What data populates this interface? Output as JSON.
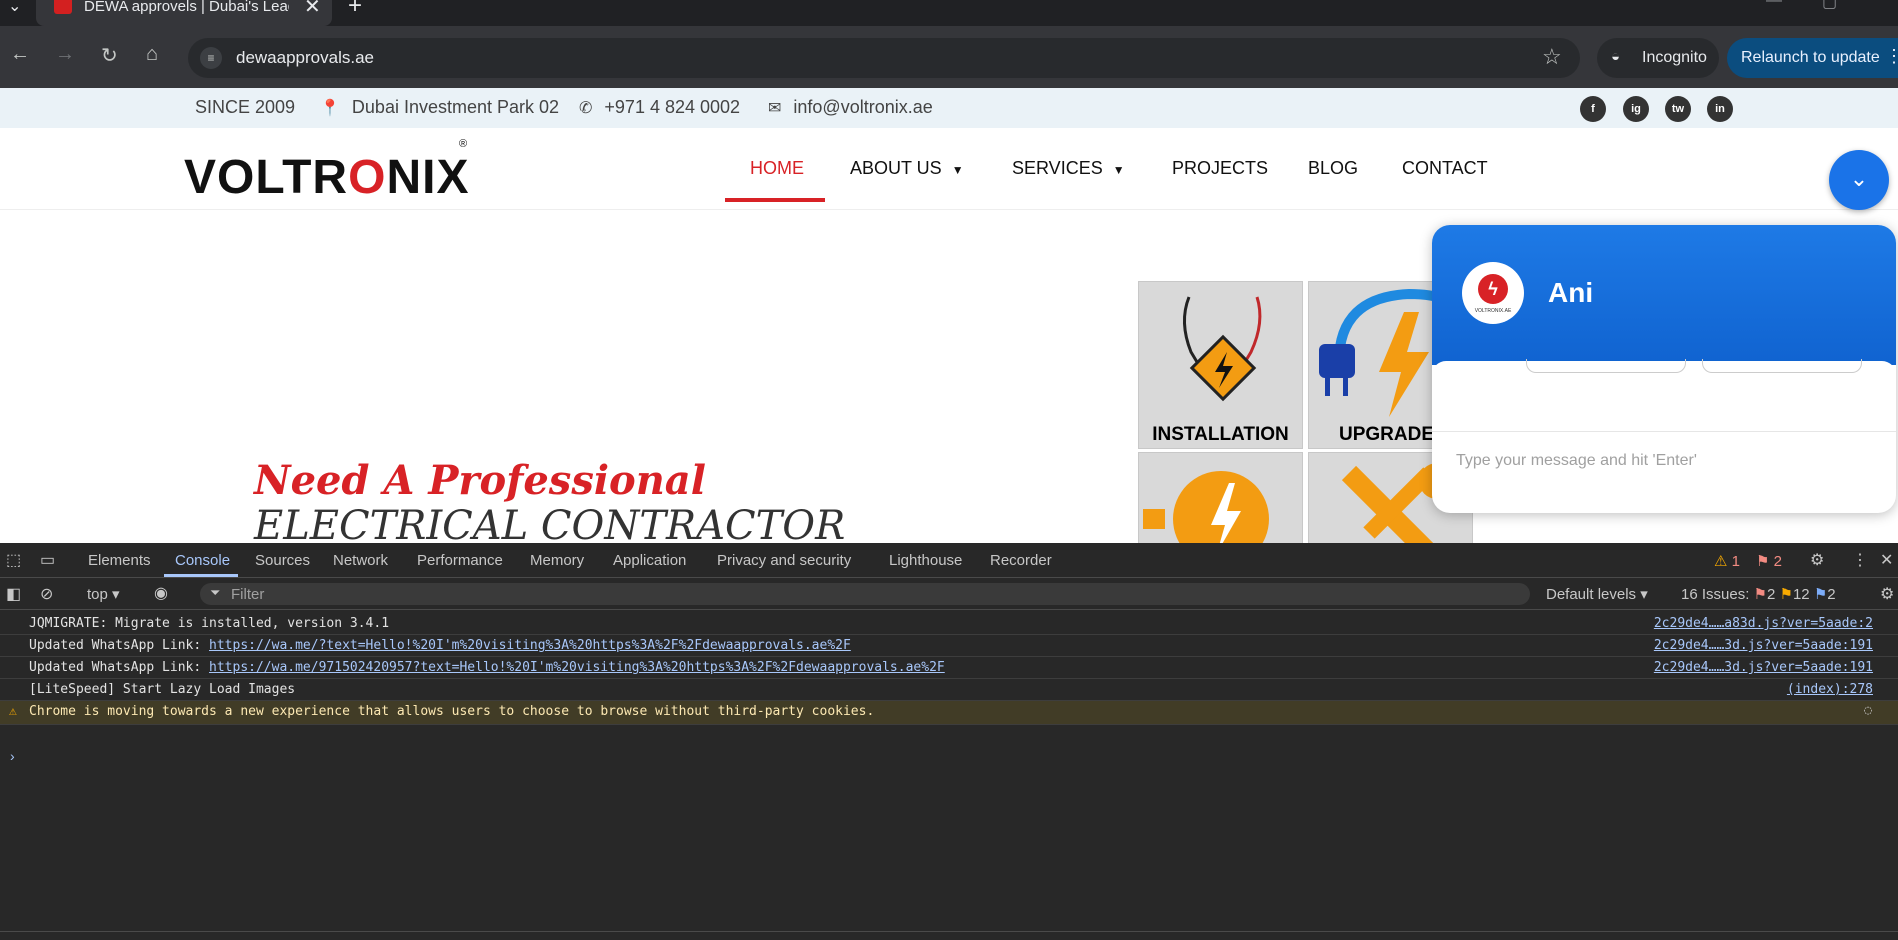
{
  "browser": {
    "tab_title": "DEWA approvels | Dubai's Leading",
    "close_glyph": "✕",
    "newtab_glyph": "+",
    "url": "dewaapprovals.ae",
    "incognito_label": "Incognito",
    "relaunch_label": "Relaunch to update"
  },
  "topbar": {
    "since": "SINCE 2009",
    "location": "Dubai Investment Park 02",
    "phone": "+971 4 824 0002",
    "email": "info@voltronix.ae",
    "socials": [
      "f",
      "ig",
      "tw",
      "in"
    ]
  },
  "nav": {
    "logo_pre": "VOLTR",
    "logo_o": "O",
    "logo_post": "NIX",
    "logo_reg": "®",
    "items": [
      {
        "label": "HOME"
      },
      {
        "label": "ABOUT US"
      },
      {
        "label": "SERVICES"
      },
      {
        "label": "PROJECTS"
      },
      {
        "label": "BLOG"
      },
      {
        "label": "CONTACT"
      }
    ]
  },
  "hero": {
    "line1": "Need A Professional",
    "line2": "ELECTRICAL CONTRACTOR"
  },
  "tiles": [
    {
      "caption": "INSTALLATION"
    },
    {
      "caption": "UPGRADE"
    }
  ],
  "chat": {
    "name": "Ani",
    "avatar_text": "VOLTRONIX.AE",
    "placeholder": "Type your message and hit 'Enter'"
  },
  "devtools": {
    "tabs": [
      "Elements",
      "Console",
      "Sources",
      "Network",
      "Performance",
      "Memory",
      "Application",
      "Privacy and security",
      "Lighthouse",
      "Recorder"
    ],
    "warn_count": "1",
    "error_count": "2",
    "context": "top",
    "filter_placeholder": "Filter",
    "levels": "Default levels",
    "issues_label": "16 Issues:",
    "issues_errors": "2",
    "issues_warnings": "12",
    "issues_info": "2",
    "logs": [
      {
        "prefix": "JQMIGRATE: Migrate is installed, version 3.4.1",
        "link": "",
        "source": "2c29de4……a83d.js?ver=5aade:2"
      },
      {
        "prefix": "Updated WhatsApp Link: ",
        "link": "https://wa.me/?text=Hello!%20I'm%20visiting%3A%20https%3A%2F%2Fdewaapprovals.ae%2F",
        "source": "2c29de4……3d.js?ver=5aade:191"
      },
      {
        "prefix": "Updated WhatsApp Link: ",
        "link": "https://wa.me/971502420957?text=Hello!%20I'm%20visiting%3A%20https%3A%2F%2Fdewaapprovals.ae%2F",
        "source": "2c29de4……3d.js?ver=5aade:191"
      },
      {
        "prefix": "[LiteSpeed] Start Lazy Load Images",
        "link": "",
        "source": "(index):278"
      }
    ],
    "warning": "Chrome is moving towards a new experience that allows users to choose to browse without third-party cookies.",
    "prompt": "›"
  },
  "colors": {
    "brand_red": "#d82226",
    "chat_blue": "#1a73e8",
    "devtools_bg": "#282828",
    "link_blue": "#a8c7fa"
  }
}
